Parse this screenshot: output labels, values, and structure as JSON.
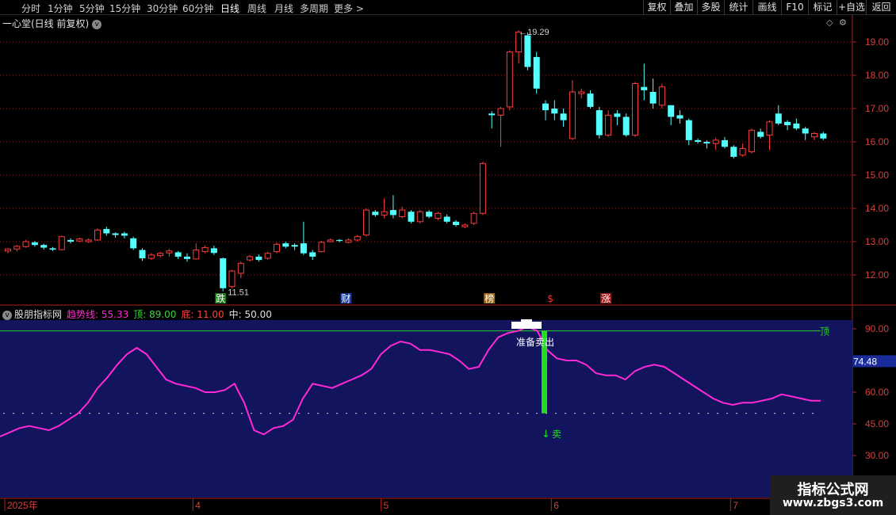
{
  "toolbar": {
    "periods": [
      {
        "label": "分时",
        "active": false
      },
      {
        "label": "1分钟",
        "active": false
      },
      {
        "label": "5分钟",
        "active": false
      },
      {
        "label": "15分钟",
        "active": false
      },
      {
        "label": "30分钟",
        "active": false
      },
      {
        "label": "60分钟",
        "active": false
      },
      {
        "label": "日线",
        "active": true
      },
      {
        "label": "周线",
        "active": false
      },
      {
        "label": "月线",
        "active": false
      },
      {
        "label": "多周期",
        "active": false
      },
      {
        "label": "更多 >",
        "active": false
      }
    ],
    "buttons": [
      "复权",
      "叠加",
      "多股",
      "统计",
      "画线",
      "F10",
      "标记",
      "+自选",
      "返回"
    ]
  },
  "main_chart": {
    "title": "一心堂(日线 前复权)",
    "price_axis": {
      "min": 11.2,
      "max": 19.6,
      "ticks": [
        "19.00",
        "18.00",
        "17.00",
        "16.00",
        "15.00",
        "14.00",
        "13.00",
        "12.00"
      ]
    },
    "high_annotation": "19.29",
    "low_annotation": "11.51",
    "event_marks": [
      {
        "label": "跌",
        "color": "#ffffff",
        "bg": "#1a7a1a",
        "bar": 24
      },
      {
        "label": "财",
        "color": "#ffffff",
        "bg": "#1a3a9a",
        "bar": 38
      },
      {
        "label": "榜",
        "color": "#ffffff",
        "bg": "#9a6a1a",
        "bar": 54
      },
      {
        "label": "$",
        "color": "#ff3030",
        "bg": "",
        "bar": 61
      },
      {
        "label": "涨",
        "color": "#ffffff",
        "bg": "#9a1a1a",
        "bar": 67
      }
    ],
    "up_color": "#ff3b3b",
    "down_color": "#54ffff"
  },
  "indicator": {
    "name": "股朋指标网",
    "trend_label": "趋势线: 55.33",
    "top_label": "顶: 89.00",
    "bottom_label": "底: 11.00",
    "mid_label": "中: 50.00",
    "top_line_text": "顶",
    "ready_sell_text": "准备卖出",
    "sell_text": "卖",
    "current_value": "74.48",
    "axis": {
      "min": 22,
      "max": 96,
      "ticks": [
        "90.00",
        "75.00",
        "60.00",
        "45.00",
        "30.00"
      ]
    },
    "top_level": 89,
    "mid_level": 50,
    "trend_color": "#ff2ad4",
    "panel_bg": "#12145e"
  },
  "x_axis": {
    "labels": [
      {
        "text": "2025年",
        "bar": 0
      },
      {
        "text": "4",
        "bar": 21
      },
      {
        "text": "5",
        "bar": 42
      },
      {
        "text": "6",
        "bar": 61
      },
      {
        "text": "7",
        "bar": 81
      }
    ]
  },
  "chart_data": {
    "type": "candlestick",
    "candles": [
      [
        12.72,
        12.78,
        12.65,
        12.8
      ],
      [
        12.78,
        12.86,
        12.7,
        12.9
      ],
      [
        12.85,
        13.0,
        12.82,
        13.05
      ],
      [
        12.98,
        12.9,
        12.85,
        13.02
      ],
      [
        12.9,
        12.82,
        12.76,
        12.94
      ],
      [
        12.8,
        12.76,
        12.72,
        12.84
      ],
      [
        12.76,
        13.15,
        12.74,
        13.18
      ],
      [
        13.05,
        13.0,
        12.95,
        13.1
      ],
      [
        13.02,
        13.08,
        12.98,
        13.12
      ],
      [
        13.0,
        13.05,
        12.96,
        13.1
      ],
      [
        13.05,
        13.35,
        13.02,
        13.4
      ],
      [
        13.38,
        13.25,
        13.18,
        13.45
      ],
      [
        13.25,
        13.2,
        13.12,
        13.28
      ],
      [
        13.25,
        13.18,
        13.1,
        13.3
      ],
      [
        13.1,
        12.8,
        12.75,
        13.15
      ],
      [
        12.75,
        12.5,
        12.42,
        12.8
      ],
      [
        12.5,
        12.6,
        12.45,
        12.66
      ],
      [
        12.58,
        12.65,
        12.52,
        12.7
      ],
      [
        12.66,
        12.72,
        12.55,
        12.78
      ],
      [
        12.68,
        12.55,
        12.48,
        12.72
      ],
      [
        12.55,
        12.48,
        12.4,
        12.65
      ],
      [
        12.48,
        12.75,
        12.46,
        12.95
      ],
      [
        12.7,
        12.82,
        12.65,
        12.88
      ],
      [
        12.8,
        12.66,
        12.6,
        12.88
      ],
      [
        12.5,
        11.6,
        11.51,
        12.52
      ],
      [
        11.65,
        12.12,
        11.6,
        12.15
      ],
      [
        12.05,
        12.35,
        11.9,
        12.4
      ],
      [
        12.45,
        12.55,
        12.4,
        12.6
      ],
      [
        12.55,
        12.45,
        12.4,
        12.62
      ],
      [
        12.5,
        12.65,
        12.45,
        12.7
      ],
      [
        12.7,
        12.92,
        12.65,
        12.98
      ],
      [
        12.95,
        12.85,
        12.8,
        13.0
      ],
      [
        12.9,
        12.85,
        12.75,
        12.95
      ],
      [
        12.95,
        12.65,
        12.6,
        13.6
      ],
      [
        12.68,
        12.55,
        12.45,
        12.75
      ],
      [
        12.7,
        12.98,
        12.68,
        13.02
      ],
      [
        13.0,
        13.05,
        12.98,
        13.1
      ],
      [
        13.05,
        13.02,
        12.98,
        13.08
      ],
      [
        12.98,
        13.05,
        12.95,
        13.1
      ],
      [
        13.05,
        13.15,
        13.0,
        13.2
      ],
      [
        13.2,
        13.95,
        13.15,
        14.0
      ],
      [
        13.9,
        13.8,
        13.75,
        13.95
      ],
      [
        13.8,
        13.9,
        13.7,
        14.3
      ],
      [
        13.95,
        13.8,
        13.7,
        14.4
      ],
      [
        13.75,
        13.95,
        13.7,
        14.05
      ],
      [
        13.9,
        13.6,
        13.55,
        13.95
      ],
      [
        13.6,
        13.9,
        13.55,
        13.95
      ],
      [
        13.9,
        13.75,
        13.7,
        13.95
      ],
      [
        13.7,
        13.85,
        13.65,
        13.9
      ],
      [
        13.75,
        13.6,
        13.55,
        13.82
      ],
      [
        13.6,
        13.5,
        13.45,
        13.65
      ],
      [
        13.45,
        13.5,
        13.4,
        13.55
      ],
      [
        13.55,
        13.85,
        13.5,
        13.9
      ],
      [
        13.85,
        15.35,
        13.8,
        15.4
      ],
      [
        16.85,
        16.8,
        16.4,
        16.92
      ],
      [
        16.8,
        17.0,
        15.85,
        17.05
      ],
      [
        17.05,
        18.7,
        16.95,
        18.75
      ],
      [
        18.7,
        19.3,
        18.35,
        19.35
      ],
      [
        19.2,
        18.25,
        18.15,
        19.29
      ],
      [
        18.55,
        17.6,
        17.45,
        18.7
      ],
      [
        17.15,
        16.95,
        16.65,
        17.25
      ],
      [
        17.0,
        16.85,
        16.65,
        17.25
      ],
      [
        16.85,
        16.65,
        16.45,
        17.0
      ],
      [
        16.1,
        17.5,
        16.05,
        17.85
      ],
      [
        17.45,
        17.5,
        17.3,
        17.6
      ],
      [
        17.45,
        17.05,
        17.0,
        17.55
      ],
      [
        16.95,
        16.2,
        16.1,
        17.05
      ],
      [
        16.2,
        16.8,
        16.15,
        16.95
      ],
      [
        16.85,
        16.75,
        16.5,
        16.95
      ],
      [
        16.75,
        16.2,
        16.15,
        16.85
      ],
      [
        16.2,
        17.75,
        16.15,
        17.8
      ],
      [
        17.65,
        17.55,
        17.25,
        18.35
      ],
      [
        17.5,
        17.15,
        17.0,
        17.9
      ],
      [
        17.1,
        17.65,
        17.0,
        17.75
      ],
      [
        17.1,
        16.75,
        16.5,
        17.1
      ],
      [
        16.8,
        16.7,
        16.55,
        16.95
      ],
      [
        16.65,
        16.05,
        15.9,
        16.7
      ],
      [
        16.05,
        16.0,
        15.95,
        16.1
      ],
      [
        16.0,
        15.95,
        15.8,
        16.05
      ],
      [
        15.95,
        16.05,
        15.75,
        16.12
      ],
      [
        16.05,
        15.85,
        15.8,
        16.15
      ],
      [
        15.85,
        15.55,
        15.5,
        15.9
      ],
      [
        15.6,
        15.8,
        15.55,
        15.95
      ],
      [
        15.7,
        16.35,
        15.65,
        16.4
      ],
      [
        16.3,
        16.15,
        16.1,
        16.4
      ],
      [
        16.2,
        16.6,
        15.75,
        16.65
      ],
      [
        16.85,
        16.55,
        16.5,
        17.1
      ],
      [
        16.6,
        16.5,
        16.35,
        16.65
      ],
      [
        16.55,
        16.4,
        16.35,
        16.7
      ],
      [
        16.4,
        16.25,
        16.05,
        16.45
      ],
      [
        16.15,
        16.25,
        16.05,
        16.3
      ],
      [
        16.25,
        16.1,
        16.05,
        16.3
      ]
    ],
    "trend_line": [
      39,
      41,
      43,
      44,
      43,
      42,
      44,
      47,
      50,
      55,
      62,
      67,
      73,
      78,
      81,
      78,
      72,
      66,
      64,
      63,
      62,
      60,
      60,
      61,
      64,
      55,
      42,
      40,
      43,
      44,
      47,
      57,
      64,
      63,
      62,
      64,
      66,
      68,
      71,
      78,
      82,
      84,
      83,
      80,
      80,
      79,
      78,
      75,
      71,
      72,
      80,
      86,
      88,
      89,
      91,
      89,
      80,
      76,
      75,
      75,
      73,
      69,
      68,
      68,
      66,
      70,
      72,
      73,
      72,
      69,
      66,
      63,
      60,
      57,
      55,
      54,
      55,
      55,
      56,
      57,
      59,
      58,
      57,
      56,
      56
    ]
  }
}
